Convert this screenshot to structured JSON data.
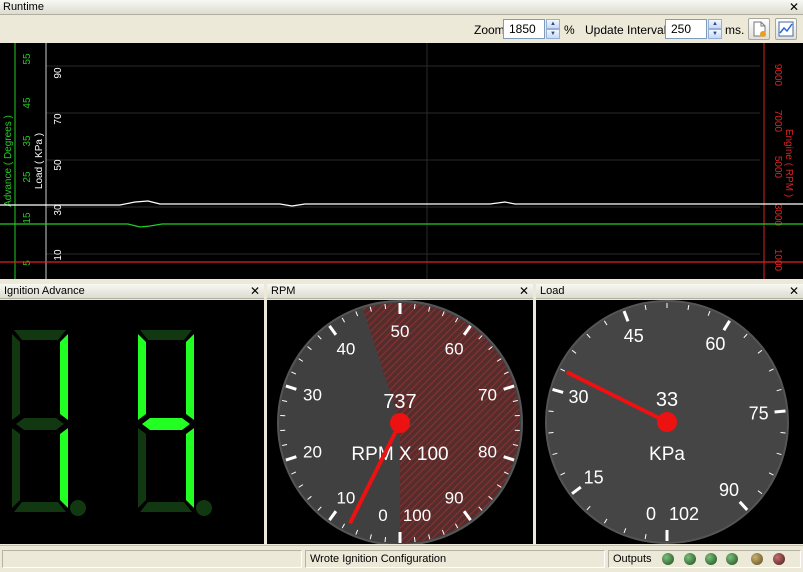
{
  "runtime": {
    "title": "Runtime",
    "zoom_label": "Zoom",
    "zoom_value": "1850",
    "zoom_unit": "%",
    "interval_label": "Update Interval",
    "interval_value": "250",
    "interval_unit": "ms.",
    "chart": {
      "left_axis_label": "Advance ( Degrees )",
      "left_ticks": [
        "55",
        "45",
        "35",
        "25",
        "15",
        "5"
      ],
      "load_axis_label": "Load ( KPa )",
      "load_ticks": [
        "90",
        "70",
        "50",
        "30",
        "10"
      ],
      "right_axis_label": "Engine ( RPM )",
      "right_ticks": [
        "9000",
        "7000",
        "5000",
        "3000",
        "1000"
      ],
      "colors": {
        "advance": "#22cc22",
        "load": "#ffffff",
        "rpm": "#dd2222"
      }
    }
  },
  "ignition": {
    "title": "Ignition Advance",
    "digits": [
      "1",
      "4"
    ],
    "color": "#22ff22"
  },
  "rpm_gauge": {
    "title": "RPM",
    "value": "737",
    "unit": "RPM X 100",
    "ticks": [
      "0",
      "10",
      "20",
      "30",
      "40",
      "50",
      "60",
      "70",
      "80",
      "90",
      "100"
    ],
    "needle_value": 7.37
  },
  "load_gauge": {
    "title": "Load",
    "value": "33",
    "unit": "KPa",
    "ticks": [
      "0",
      "15",
      "30",
      "45",
      "60",
      "75",
      "90",
      "102"
    ],
    "needle_value": 33
  },
  "status": {
    "message": "Wrote Ignition Configuration",
    "outputs_label": "Outputs"
  }
}
